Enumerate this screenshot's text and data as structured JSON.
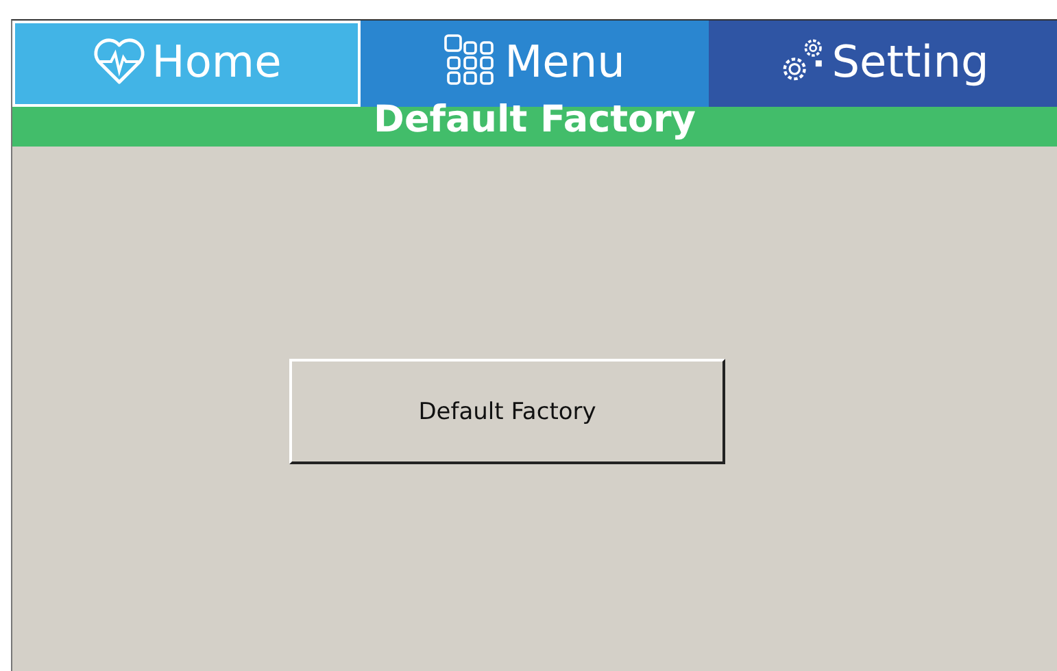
{
  "tabs": [
    {
      "label": "Home",
      "kind": "home",
      "color": "#42b4e6",
      "selected": true
    },
    {
      "label": "Menu",
      "kind": "menu",
      "color": "#2a86d0",
      "selected": false
    },
    {
      "label": "Setting",
      "kind": "setting",
      "color": "#2f55a4",
      "selected": false
    }
  ],
  "page_title": "Default Factory",
  "action_button": {
    "label": "Default Factory"
  }
}
